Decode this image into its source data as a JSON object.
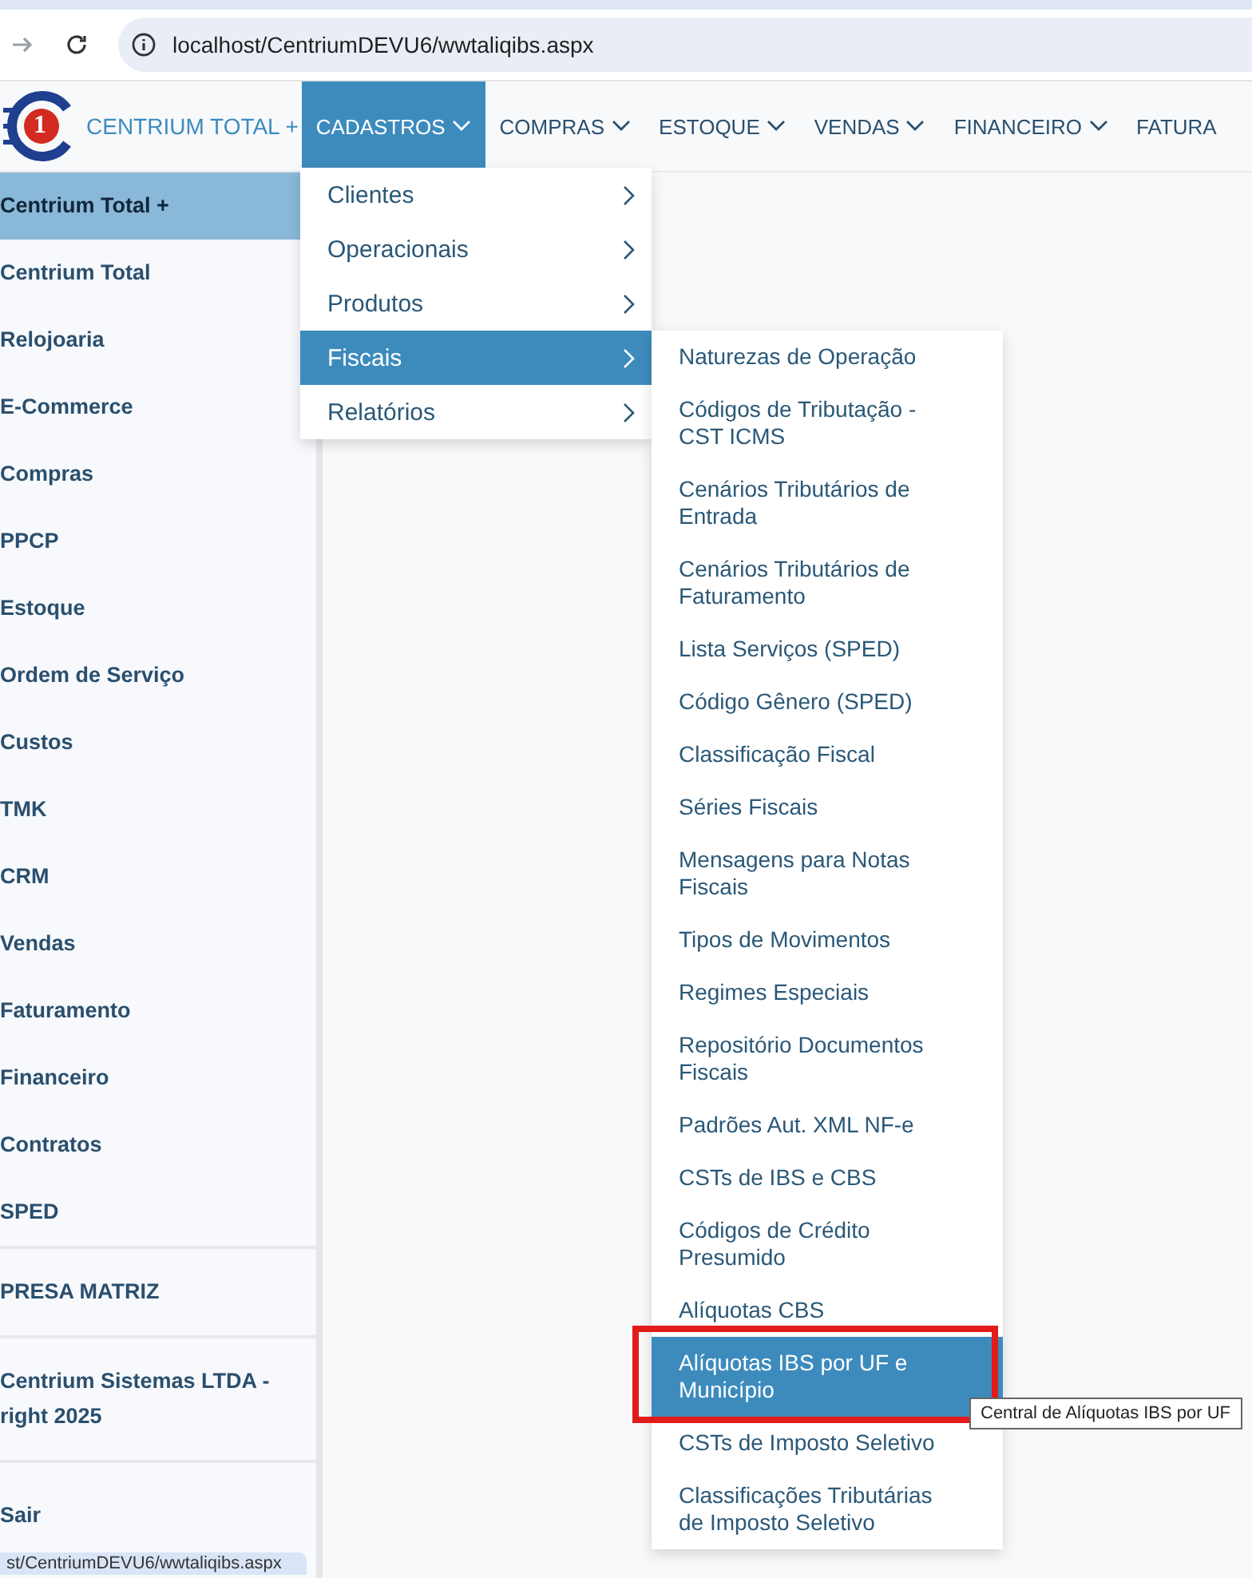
{
  "browser": {
    "url": "localhost/CentriumDEVU6/wwtaliqibs.aspx"
  },
  "navbar": {
    "logo_badge": "1",
    "brand": "CENTRIUM TOTAL +",
    "menus": [
      {
        "label": "CADASTROS",
        "selected": true
      },
      {
        "label": "COMPRAS",
        "selected": false
      },
      {
        "label": "ESTOQUE",
        "selected": false
      },
      {
        "label": "VENDAS",
        "selected": false
      },
      {
        "label": "FINANCEIRO",
        "selected": false
      },
      {
        "label": "FATURA",
        "selected": false
      }
    ]
  },
  "sidebar": {
    "items": [
      {
        "label": "Centrium Total +",
        "selected": true
      },
      {
        "label": "Centrium Total",
        "selected": false
      },
      {
        "label": "Relojoaria",
        "selected": false
      },
      {
        "label": "E-Commerce",
        "selected": false
      },
      {
        "label": "Compras",
        "selected": false
      },
      {
        "label": "PPCP",
        "selected": false
      },
      {
        "label": "Estoque",
        "selected": false
      },
      {
        "label": "Ordem de Serviço",
        "selected": false
      },
      {
        "label": "Custos",
        "selected": false
      },
      {
        "label": "TMK",
        "selected": false
      },
      {
        "label": "CRM",
        "selected": false
      },
      {
        "label": "Vendas",
        "selected": false
      },
      {
        "label": "Faturamento",
        "selected": false
      },
      {
        "label": "Financeiro",
        "selected": false
      },
      {
        "label": "Contratos",
        "selected": false
      },
      {
        "label": "SPED",
        "selected": false
      }
    ],
    "company": "PRESA MATRIZ",
    "copyright": [
      "Centrium Sistemas LTDA -",
      "right 2025"
    ],
    "logout": "Sair"
  },
  "menu": {
    "items": [
      {
        "label": "Clientes",
        "selected": false
      },
      {
        "label": "Operacionais",
        "selected": false
      },
      {
        "label": "Produtos",
        "selected": false
      },
      {
        "label": "Fiscais",
        "selected": true
      },
      {
        "label": "Relatórios",
        "selected": false
      }
    ]
  },
  "submenu": {
    "items": [
      {
        "label": "Naturezas de Operação",
        "selected": false
      },
      {
        "label": "Códigos de Tributação - CST ICMS",
        "selected": false
      },
      {
        "label": "Cenários Tributários de Entrada",
        "selected": false
      },
      {
        "label": "Cenários Tributários de Faturamento",
        "selected": false
      },
      {
        "label": "Lista Serviços (SPED)",
        "selected": false
      },
      {
        "label": "Código Gênero (SPED)",
        "selected": false
      },
      {
        "label": "Classificação Fiscal",
        "selected": false
      },
      {
        "label": "Séries Fiscais",
        "selected": false
      },
      {
        "label": "Mensagens para Notas Fiscais",
        "selected": false
      },
      {
        "label": "Tipos de Movimentos",
        "selected": false
      },
      {
        "label": "Regimes Especiais",
        "selected": false
      },
      {
        "label": "Repositório Documentos Fiscais",
        "selected": false
      },
      {
        "label": "Padrões Aut. XML NF-e",
        "selected": false
      },
      {
        "label": "CSTs de IBS e CBS",
        "selected": false
      },
      {
        "label": "Códigos de Crédito Presumido",
        "selected": false
      },
      {
        "label": "Alíquotas CBS",
        "selected": false
      },
      {
        "label": "Alíquotas IBS por UF e Município",
        "selected": true
      },
      {
        "label": "CSTs de Imposto Seletivo",
        "selected": false
      },
      {
        "label": "Classificações Tributárias de Imposto Seletivo",
        "selected": false
      }
    ]
  },
  "tooltip": "Central de Alíquotas IBS por UF",
  "status_url": "st/CentriumDEVU6/wwtaliqibs.aspx"
}
